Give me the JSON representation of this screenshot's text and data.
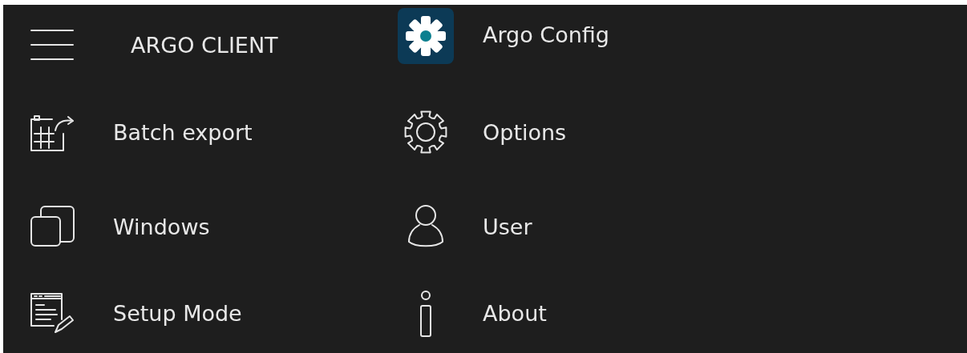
{
  "header": {
    "title": "ARGO CLIENT"
  },
  "app": {
    "title": "Argo Config"
  },
  "left_menu": [
    {
      "label": "Batch export"
    },
    {
      "label": "Windows"
    },
    {
      "label": "Setup Mode"
    }
  ],
  "right_menu": [
    {
      "label": "Options"
    },
    {
      "label": "User"
    },
    {
      "label": "About"
    }
  ]
}
